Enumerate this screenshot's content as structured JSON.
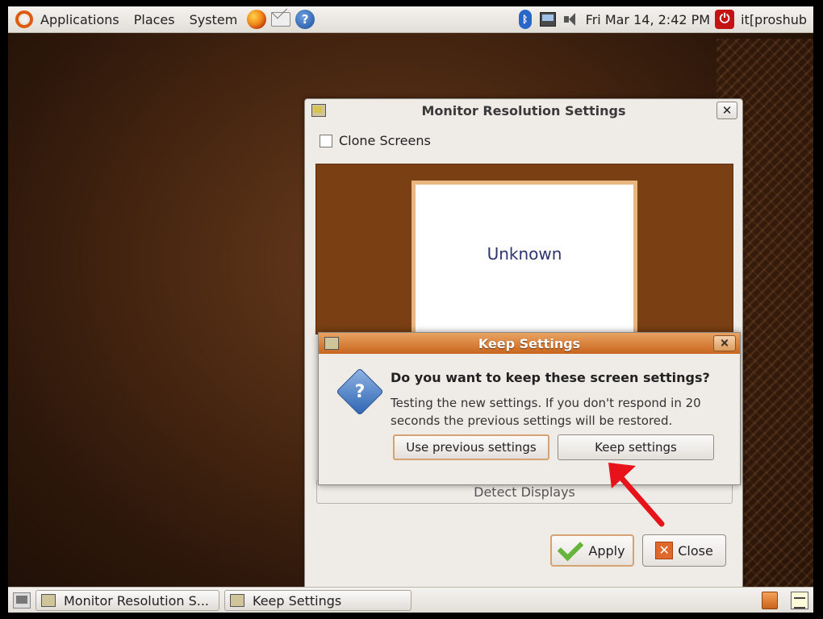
{
  "top_panel": {
    "menus": [
      "Applications",
      "Places",
      "System"
    ],
    "launchers": [
      "firefox-icon",
      "mail-icon",
      "help-icon"
    ],
    "clock": "Fri Mar 14,  2:42 PM",
    "user": "it[proshub"
  },
  "main_window": {
    "title": "Monitor Resolution Settings",
    "close_glyph": "✕",
    "clone_label": "Clone Screens",
    "monitor_name": "Unknown",
    "detect_label": "Detect Displays",
    "apply_label": "Apply",
    "close_label": "Close"
  },
  "dialog": {
    "title": "Keep Settings",
    "close_glyph": "✕",
    "heading": "Do you want to keep these screen settings?",
    "body": "Testing the new settings. If you don't respond in 20 seconds the previous settings will be restored.",
    "use_previous_label": "Use previous settings",
    "keep_label": "Keep settings"
  },
  "taskbar": {
    "tasks": [
      "Monitor Resolution S...",
      "Keep Settings"
    ]
  },
  "colors": {
    "panel_bg": "#e9e6e2",
    "dialog_title": "#d07a33",
    "monitor_bg": "#7a3f12",
    "arrow": "#e8121b"
  }
}
